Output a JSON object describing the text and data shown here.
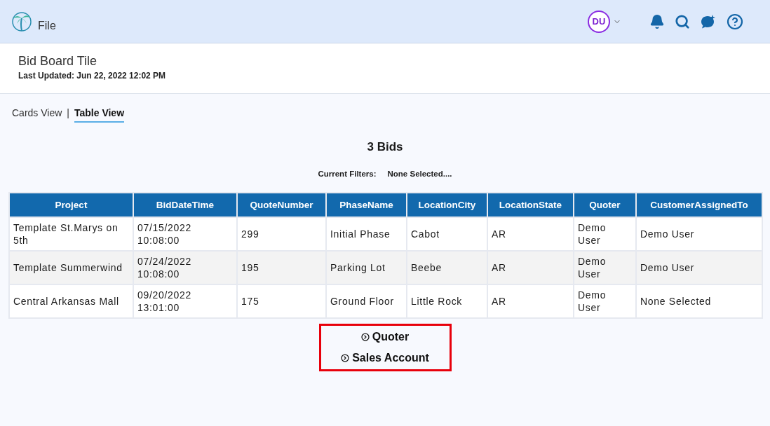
{
  "header": {
    "menu_label": "File",
    "avatar_initials": "DU"
  },
  "page": {
    "title": "Bid Board Tile",
    "last_updated_label": "Last Updated:",
    "last_updated_value": "Jun 22, 2022 12:02 PM"
  },
  "view_tabs": {
    "separator": "|",
    "tabs": [
      {
        "label": "Cards View",
        "selected": false
      },
      {
        "label": "Table View",
        "selected": true
      }
    ]
  },
  "summary": {
    "count": "3 Bids",
    "filters_label": "Current Filters:",
    "filters_value": "None Selected...."
  },
  "table": {
    "columns": [
      "Project",
      "BidDateTime",
      "QuoteNumber",
      "PhaseName",
      "LocationCity",
      "LocationState",
      "Quoter",
      "CustomerAssignedTo"
    ],
    "rows": [
      [
        "Template St.Marys on 5th",
        "07/15/2022 10:08:00",
        "299",
        "Initial Phase",
        "Cabot",
        "AR",
        "Demo User",
        "Demo User"
      ],
      [
        "Template Summerwind",
        "07/24/2022 10:08:00",
        "195",
        "Parking Lot",
        "Beebe",
        "AR",
        "Demo User",
        "Demo User"
      ],
      [
        "Central Arkansas Mall",
        "09/20/2022 13:01:00",
        "175",
        "Ground Floor",
        "Little Rock",
        "AR",
        "Demo User",
        "None Selected"
      ]
    ]
  },
  "group_links": [
    {
      "label": "Quoter"
    },
    {
      "label": "Sales Account"
    }
  ]
}
